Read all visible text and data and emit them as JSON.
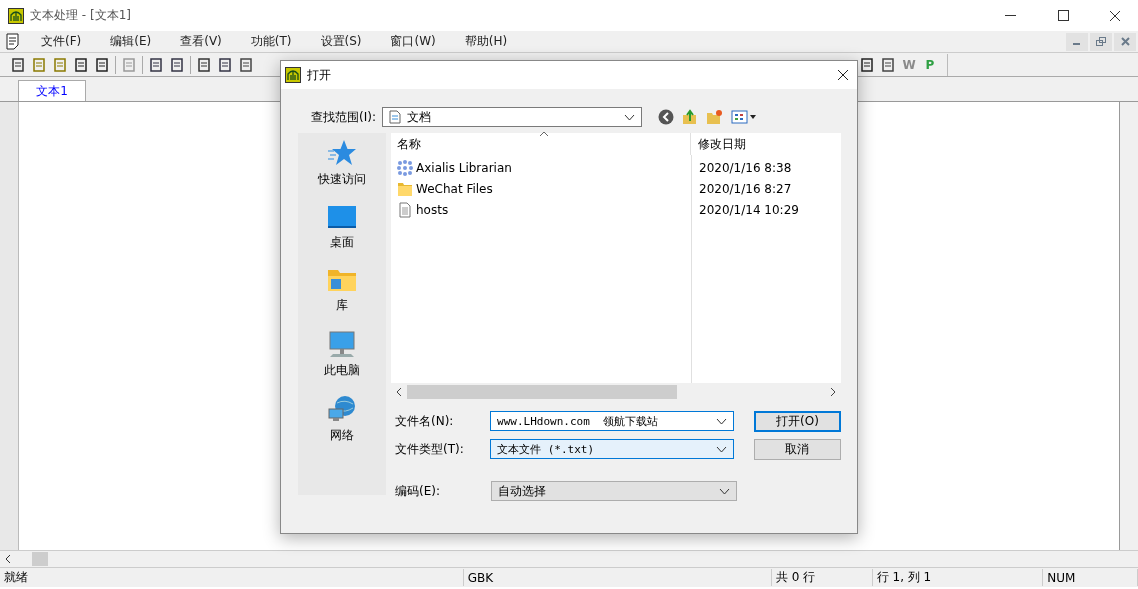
{
  "window": {
    "title": "文本处理 - [文本1]"
  },
  "menu": [
    "文件(F)",
    "编辑(E)",
    "查看(V)",
    "功能(T)",
    "设置(S)",
    "窗口(W)",
    "帮助(H)"
  ],
  "toolbar": {
    "letter_buttons": [
      {
        "label": "W",
        "color": "#8a8a8a"
      },
      {
        "label": "P",
        "color": "#2ea043"
      }
    ]
  },
  "tabs": [
    {
      "label": "文本1",
      "selected": true
    }
  ],
  "status_bar": [
    "就绪",
    "GBK",
    "共 0 行",
    "行 1, 列 1",
    "NUM"
  ],
  "dialog": {
    "title": "打开",
    "look_in_label": "查找范围(I):",
    "look_in_value": "文档",
    "places": [
      {
        "kind": "star",
        "label": "快速访问"
      },
      {
        "kind": "desktop",
        "label": "桌面"
      },
      {
        "kind": "library",
        "label": "库"
      },
      {
        "kind": "computer",
        "label": "此电脑"
      },
      {
        "kind": "network",
        "label": "网络"
      }
    ],
    "columns": [
      "名称",
      "修改日期"
    ],
    "files": [
      {
        "kind": "app",
        "name": "Axialis Librarian",
        "date": "2020/1/16 8:38"
      },
      {
        "kind": "folder",
        "name": "WeChat Files",
        "date": "2020/1/16 8:27"
      },
      {
        "kind": "file",
        "name": "hosts",
        "date": "2020/1/14 10:29"
      }
    ],
    "filename_label": "文件名(N):",
    "filename_value": "www.LHdown.com  领航下载站",
    "filetype_label": "文件类型(T):",
    "filetype_value": "文本文件 (*.txt)",
    "encoding_label": "编码(E):",
    "encoding_value": "自动选择",
    "buttons": [
      "打开(O)",
      "取消"
    ]
  }
}
